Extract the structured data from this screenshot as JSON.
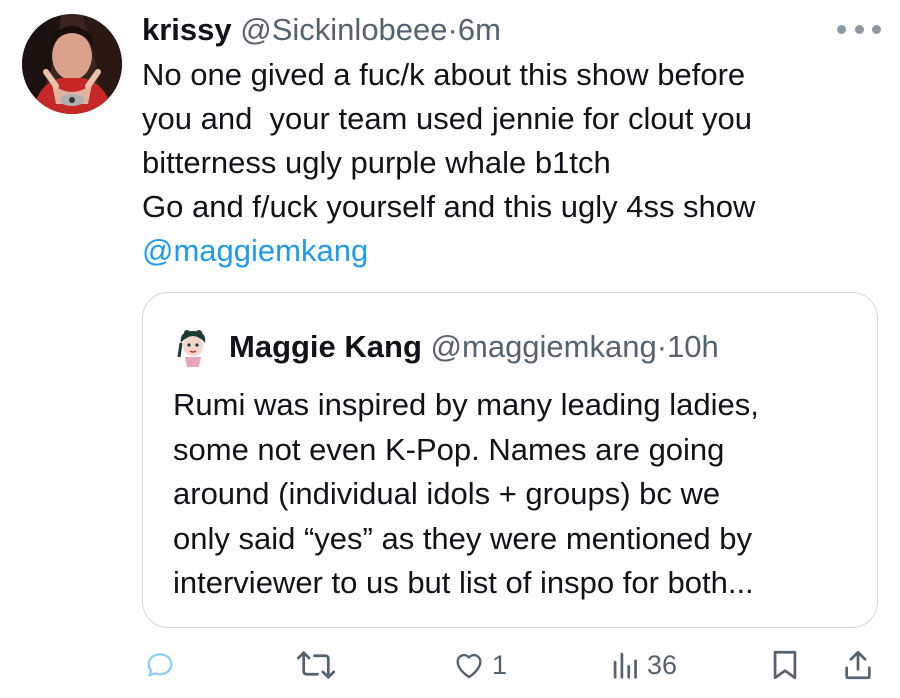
{
  "tweet": {
    "author_name": "krissy",
    "author_handle": "@Sickinlobeee",
    "separator": "·",
    "time": "6m",
    "lines": [
      "No one gived a fuc/k about this show before",
      "you and  your team used jennie for clout you",
      "bitterness ugly purple whale b1tch",
      "Go and f/uck yourself and this ugly 4ss show"
    ],
    "mention": "@maggiemkang"
  },
  "quoted_tweet": {
    "author_name": "Maggie Kang",
    "author_handle": "@maggiemkang",
    "separator": "·",
    "time": "10h",
    "lines": [
      "Rumi was inspired by many leading ladies,",
      "some not even K-Pop. Names are going",
      "around (individual idols + groups) bc we",
      "only said “yes” as they were mentioned by",
      "interviewer to us but list of inspo for both..."
    ]
  },
  "actions": {
    "likes": "1",
    "views": "36"
  },
  "icons": {
    "reply": "reply-icon",
    "retweet": "retweet-icon",
    "like": "heart-icon",
    "views": "views-icon",
    "bookmark": "bookmark-icon",
    "share": "share-icon",
    "more": "more-icon"
  },
  "colors": {
    "mention": "#1d9bf0",
    "secondary_text": "#536471",
    "border": "#cfd9de"
  }
}
